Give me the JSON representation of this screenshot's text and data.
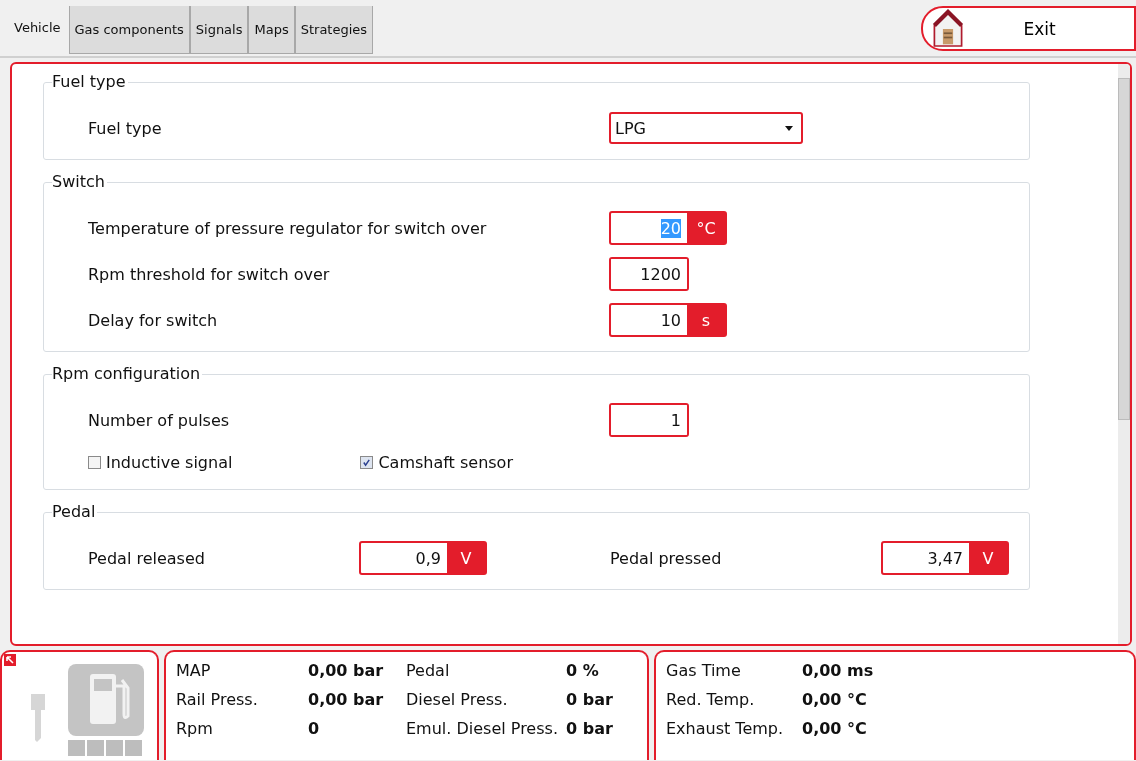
{
  "tabs": [
    {
      "label": "Vehicle",
      "selected": true
    },
    {
      "label": "Gas components",
      "selected": false
    },
    {
      "label": "Signals",
      "selected": false
    },
    {
      "label": "Maps",
      "selected": false
    },
    {
      "label": "Strategies",
      "selected": false
    }
  ],
  "exit_button": {
    "label": "Exit"
  },
  "sections": [
    {
      "title": "Fuel type",
      "rows": [
        {
          "kind": "select",
          "label": "Fuel type",
          "value": "LPG"
        }
      ]
    },
    {
      "title": "Switch",
      "rows": [
        {
          "kind": "number",
          "label": "Temperature of pressure regulator for switch over",
          "value": "20",
          "unit": "°C",
          "text_selected": true
        },
        {
          "kind": "number",
          "label": "Rpm threshold for switch over",
          "value": "1200",
          "text_selected": false
        },
        {
          "kind": "number",
          "label": "Delay for switch",
          "value": "10",
          "unit": "s",
          "text_selected": false
        }
      ]
    },
    {
      "title": "Rpm configuration",
      "rows": [
        {
          "kind": "number",
          "label": "Number of pulses",
          "value": "1",
          "text_selected": false
        },
        {
          "kind": "checks",
          "items": [
            {
              "label": "Inductive signal",
              "checked": false
            },
            {
              "label": "Camshaft sensor",
              "checked": true
            }
          ]
        }
      ]
    },
    {
      "title": "Pedal",
      "rows": [
        {
          "kind": "pair",
          "items": [
            {
              "label": "Pedal released",
              "value": "0,9",
              "unit": "V"
            },
            {
              "label": "Pedal pressed",
              "value": "3,47",
              "unit": "V"
            }
          ]
        }
      ]
    }
  ],
  "status": {
    "columns": [
      [
        {
          "label": "MAP",
          "value": "0,00 bar"
        },
        {
          "label": "Rail Press.",
          "value": "0,00 bar"
        },
        {
          "label": "Rpm",
          "value": "0"
        }
      ],
      [
        {
          "label": "Pedal",
          "value": "0 %"
        },
        {
          "label": "Diesel Press.",
          "value": "0 bar"
        },
        {
          "label": "Emul. Diesel Press.",
          "value": "0 bar"
        }
      ],
      [
        {
          "label": "Gas Time",
          "value": "0,00 ms"
        },
        {
          "label": "Red. Temp.",
          "value": "0,00 °C"
        },
        {
          "label": "Exhaust Temp.",
          "value": "0,00 °C"
        }
      ]
    ]
  }
}
